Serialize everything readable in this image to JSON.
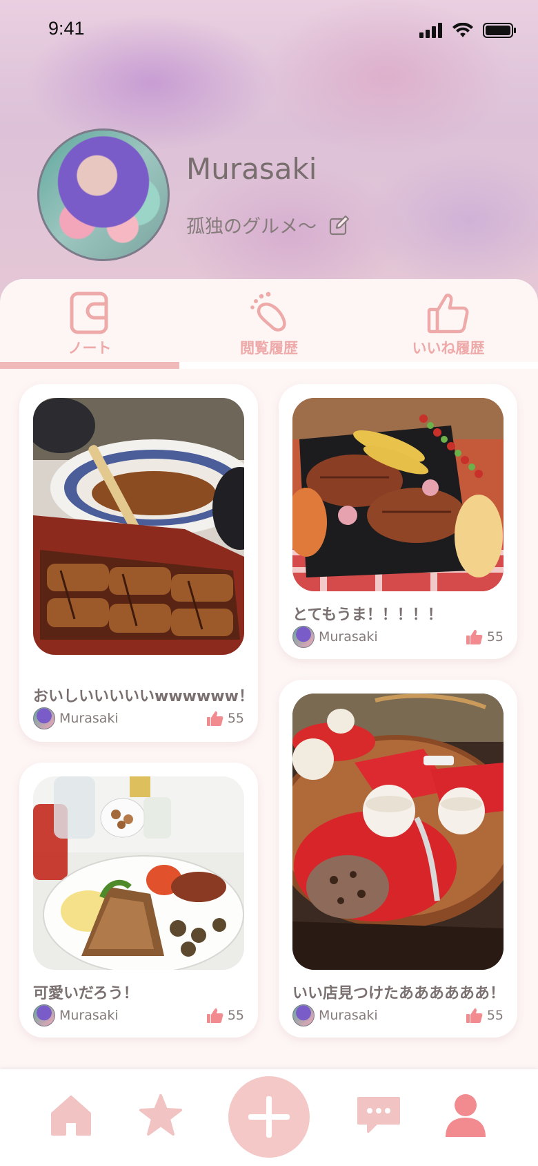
{
  "status": {
    "time": "9:41"
  },
  "profile": {
    "name": "Murasaki",
    "bio": "孤独のグルメ〜"
  },
  "tabs": [
    {
      "label": "ノート",
      "icon": "wallet-icon",
      "active": true
    },
    {
      "label": "閲覧履歴",
      "icon": "footprint-icon",
      "active": false
    },
    {
      "label": "いいね履歴",
      "icon": "thumbs-up-icon",
      "active": false
    }
  ],
  "posts": [
    {
      "title": "おいしいいいいいwwwwww！",
      "author": "Murasaki",
      "likes": "55",
      "photo": "unagi"
    },
    {
      "title": "とてもうま！！！！！",
      "author": "Murasaki",
      "likes": "55",
      "photo": "bbq"
    },
    {
      "title": "可愛いだろう！",
      "author": "Murasaki",
      "likes": "55",
      "photo": "breakfast"
    },
    {
      "title": "いい店見つけたああああああ！",
      "author": "Murasaki",
      "likes": "55",
      "photo": "cafe"
    }
  ],
  "nav": [
    {
      "icon": "home-icon"
    },
    {
      "icon": "star-icon"
    },
    {
      "icon": "plus-icon"
    },
    {
      "icon": "chat-icon"
    },
    {
      "icon": "profile-icon"
    }
  ],
  "colors": {
    "accent": "#f0b9ba",
    "accent_strong": "#f28b8f",
    "nav_icon": "#f1c3c3"
  }
}
